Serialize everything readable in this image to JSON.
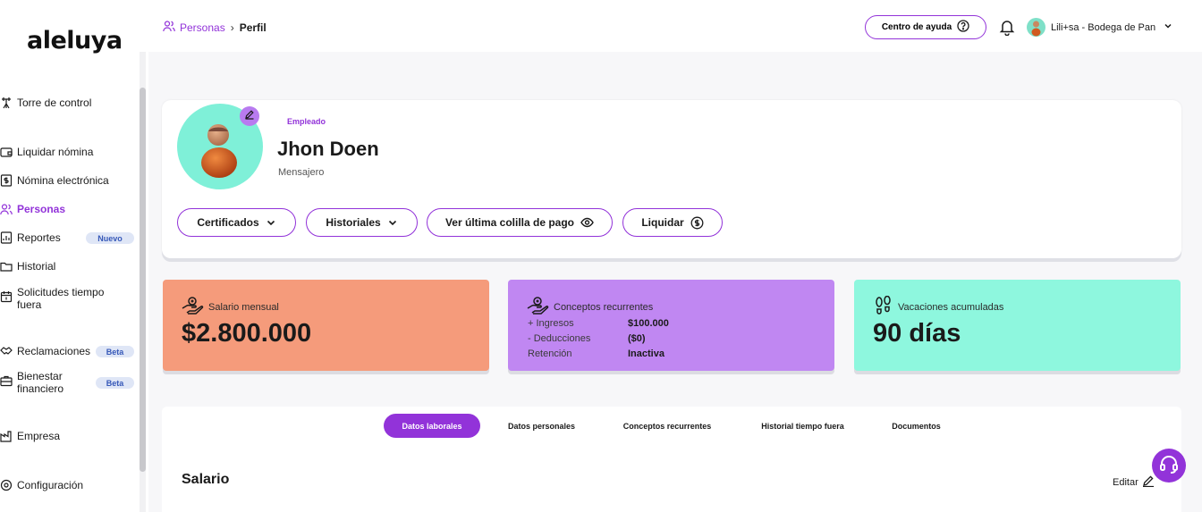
{
  "app": {
    "logo_text": "aleluya"
  },
  "sidebar": {
    "items": [
      {
        "label": "Torre de control",
        "icon": "tower-icon"
      },
      {
        "label": "Liquidar nómina",
        "icon": "wallet-icon"
      },
      {
        "label": "Nómina electrónica",
        "icon": "dollar-doc-icon"
      },
      {
        "label": "Personas",
        "icon": "people-icon",
        "active": true
      },
      {
        "label": "Reportes",
        "icon": "report-icon",
        "badge": "Nuevo"
      },
      {
        "label": "Historial",
        "icon": "folder-icon"
      },
      {
        "label": "Solicitudes tiempo fuera",
        "icon": "calendar-icon"
      },
      {
        "label": "Reclamaciones",
        "icon": "handshake-icon",
        "badge": "Beta"
      },
      {
        "label": "Bienestar financiero",
        "icon": "briefcase-icon",
        "badge": "Beta"
      },
      {
        "label": "Empresa",
        "icon": "factory-icon"
      },
      {
        "label": "Configuración",
        "icon": "gear-icon"
      }
    ]
  },
  "topbar": {
    "breadcrumb_parent": "Personas",
    "breadcrumb_sep": "›",
    "breadcrumb_current": "Perfil",
    "help_label": "Centro de ayuda",
    "user_label": "Lili+sa - Bodega de Pan"
  },
  "profile": {
    "role_tag": "Empleado",
    "name": "Jhon Doen",
    "job_title": "Mensajero",
    "actions": [
      {
        "label": "Certificados",
        "icon": "chevron-down-icon"
      },
      {
        "label": "Historiales",
        "icon": "chevron-down-icon"
      },
      {
        "label": "Ver última colilla de pago",
        "icon": "eye-icon"
      },
      {
        "label": "Liquidar",
        "icon": "dollar-circle-icon"
      }
    ]
  },
  "stats": {
    "salary": {
      "title": "Salario mensual",
      "value": "$2.800.000",
      "color": "#f59b7b"
    },
    "concepts": {
      "title": "Conceptos recurrentes",
      "color": "#c087f2",
      "rows": [
        {
          "label": "+ Ingresos",
          "value": "$100.000"
        },
        {
          "label": "- Deducciones",
          "value": "($0)"
        },
        {
          "label": "Retención",
          "value": "Inactiva"
        }
      ]
    },
    "vacation": {
      "title": "Vacaciones acumuladas",
      "value": "90 días",
      "color": "#8ef7de"
    }
  },
  "tabs": [
    {
      "label": "Datos laborales",
      "active": true
    },
    {
      "label": "Datos personales"
    },
    {
      "label": "Conceptos recurrentes"
    },
    {
      "label": "Historial tiempo fuera"
    },
    {
      "label": "Documentos"
    }
  ],
  "section": {
    "title": "Salario",
    "edit_label": "Editar"
  },
  "colors": {
    "accent": "#9233d9",
    "badge_bg": "#dfe6f6",
    "badge_text": "#3658b8"
  }
}
